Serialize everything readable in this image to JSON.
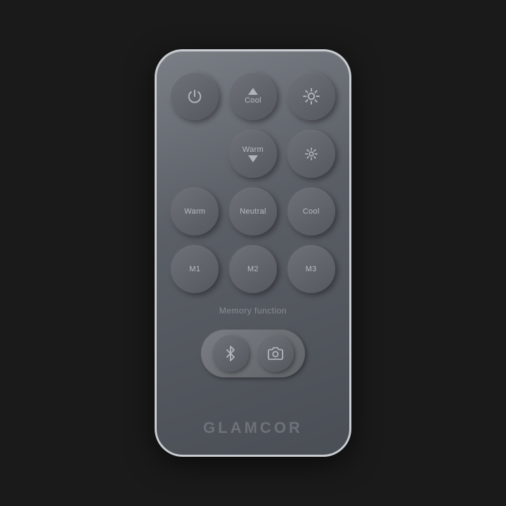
{
  "remote": {
    "brand": "GLAMCOR",
    "buttons": {
      "row1": [
        {
          "id": "power",
          "label": "",
          "type": "power"
        },
        {
          "id": "cool-up",
          "label": "Cool",
          "type": "arrow-up"
        },
        {
          "id": "brightness-high",
          "label": "",
          "type": "sun-full"
        }
      ],
      "row2": [
        {
          "id": "empty",
          "label": "",
          "type": "empty"
        },
        {
          "id": "warm-down",
          "label": "Warm",
          "type": "arrow-down"
        },
        {
          "id": "brightness-low",
          "label": "",
          "type": "sun-half"
        }
      ],
      "row3": [
        {
          "id": "warm",
          "label": "Warm",
          "type": "text"
        },
        {
          "id": "neutral",
          "label": "Neutral",
          "type": "text"
        },
        {
          "id": "cool",
          "label": "Cool",
          "type": "text"
        }
      ],
      "row4": [
        {
          "id": "m1",
          "label": "M1",
          "type": "text"
        },
        {
          "id": "m2",
          "label": "M2",
          "type": "text"
        },
        {
          "id": "m3",
          "label": "M3",
          "type": "text"
        }
      ]
    },
    "memory_label": "Memory function",
    "bottom_buttons": [
      {
        "id": "bluetooth",
        "type": "bluetooth"
      },
      {
        "id": "camera",
        "type": "camera"
      }
    ]
  }
}
